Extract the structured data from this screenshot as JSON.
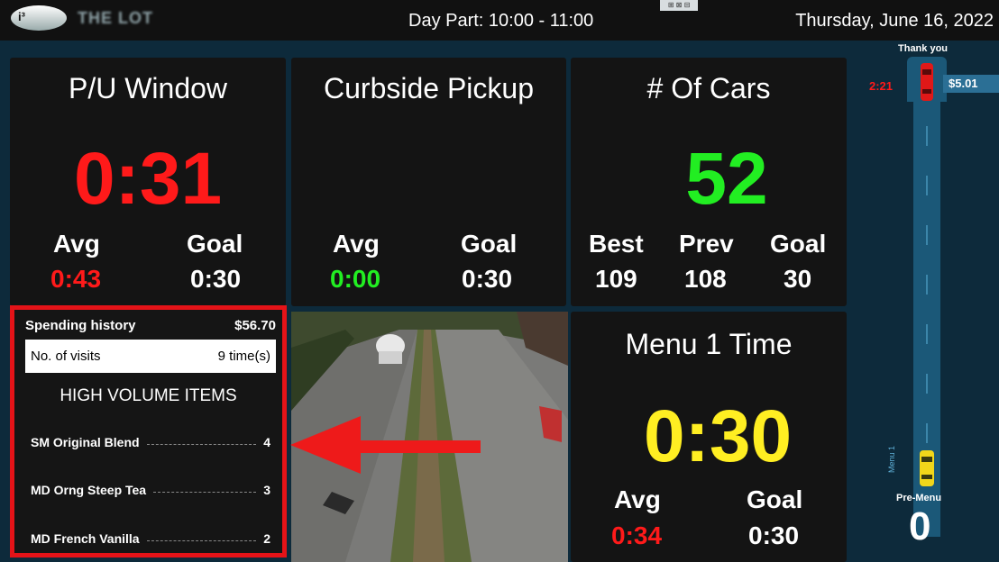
{
  "header": {
    "logo_text": "THE LOT",
    "logo_badge": "i³",
    "day_part": "Day Part: 10:00 - 11:00",
    "date": "Thursday, June 16, 2022",
    "tiny_badge": "⊞ ⊠ ⊟"
  },
  "pu_window": {
    "title": "P/U Window",
    "time": "0:31",
    "avg_label": "Avg",
    "avg_value": "0:43",
    "goal_label": "Goal",
    "goal_value": "0:30"
  },
  "curbside": {
    "title": "Curbside Pickup",
    "avg_label": "Avg",
    "avg_value": "0:00",
    "goal_label": "Goal",
    "goal_value": "0:30"
  },
  "cars": {
    "title": "# Of Cars",
    "count": "52",
    "best_label": "Best",
    "best_value": "109",
    "prev_label": "Prev",
    "prev_value": "108",
    "goal_label": "Goal",
    "goal_value": "30"
  },
  "menu1": {
    "title": "Menu 1 Time",
    "time": "0:30",
    "avg_label": "Avg",
    "avg_value": "0:34",
    "goal_label": "Goal",
    "goal_value": "0:30"
  },
  "spending": {
    "history_label": "Spending history",
    "history_value": "$56.70",
    "visits_label": "No. of visits",
    "visits_value": "9 time(s)",
    "heading": "HIGH VOLUME ITEMS",
    "items": [
      {
        "name": "SM Original Blend",
        "qty": "4"
      },
      {
        "name": "MD Orng Steep Tea",
        "qty": "3"
      },
      {
        "name": "MD French Vanilla",
        "qty": "2"
      }
    ]
  },
  "lane": {
    "thank_you": "Thank you",
    "time": "2:21",
    "amount": "$5.01",
    "menu_label": "Menu 1",
    "pre_menu_label": "Pre-Menu",
    "pre_menu_count": "0"
  },
  "colors": {
    "red": "#ff1a1a",
    "green": "#22ee22",
    "yellow": "#ffee22",
    "panel": "#141414",
    "background": "#0d2a3b",
    "lane": "#1b5878",
    "highlight_border": "#e41318"
  }
}
